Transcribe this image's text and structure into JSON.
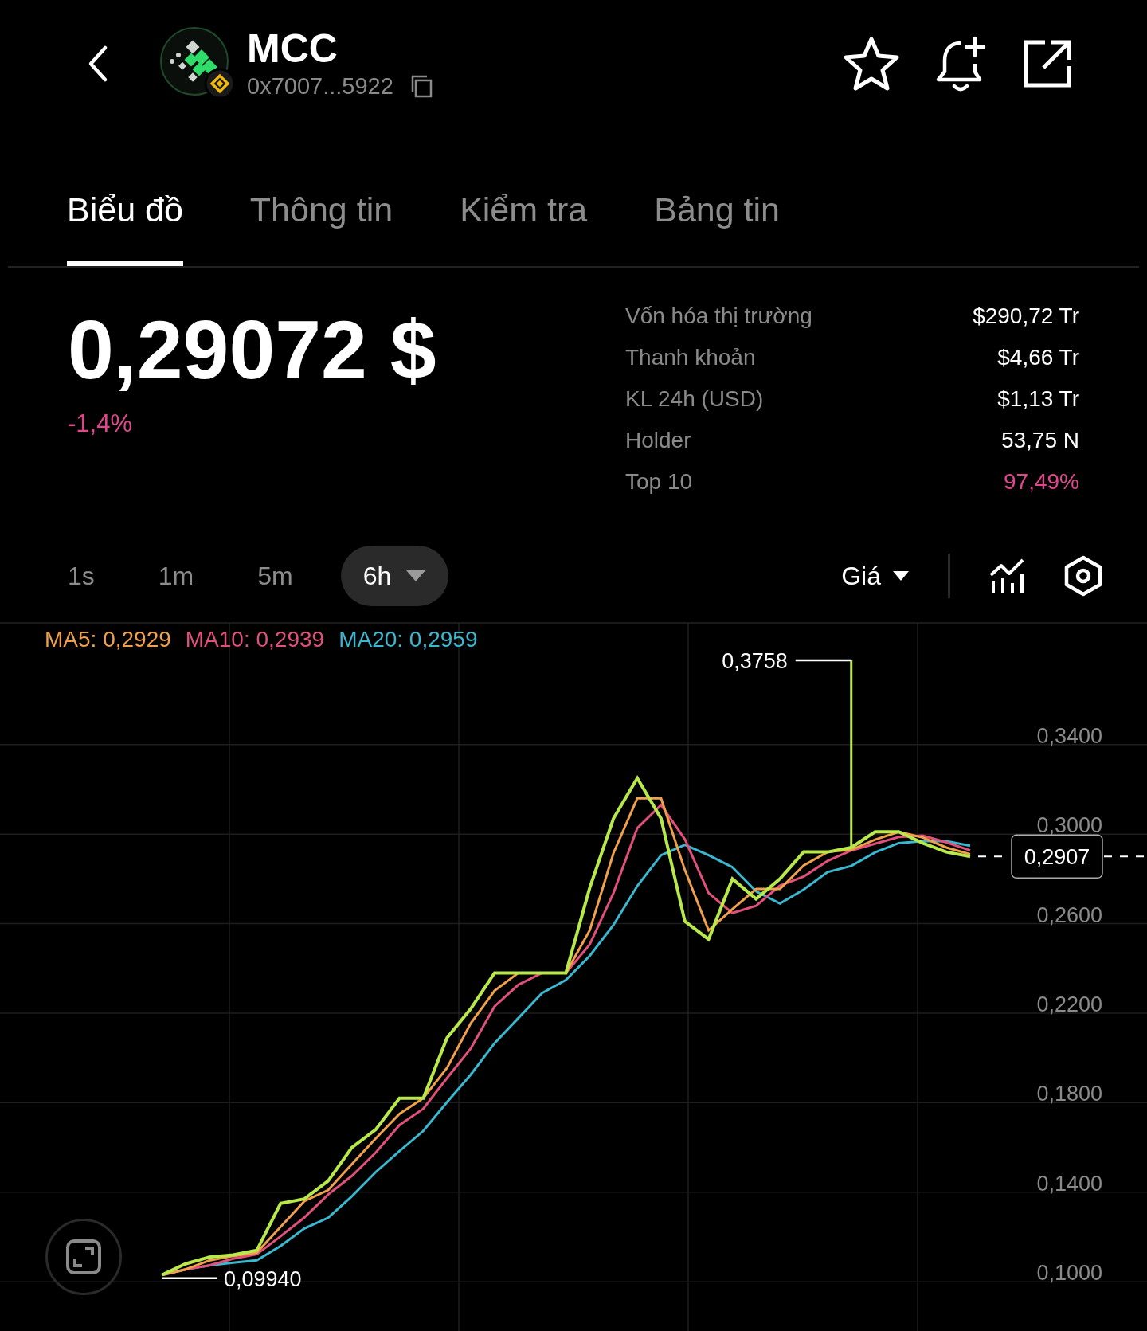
{
  "header": {
    "symbol": "MCC",
    "address": "0x7007...5922"
  },
  "tabs": [
    {
      "label": "Biểu đồ",
      "selected": true
    },
    {
      "label": "Thông tin",
      "selected": false
    },
    {
      "label": "Kiểm tra",
      "selected": false
    },
    {
      "label": "Bảng tin",
      "selected": false
    }
  ],
  "price": {
    "value": "0,29072 $",
    "change": "-1,4%"
  },
  "stats": [
    {
      "label": "Vốn hóa thị trường",
      "value": "$290,72 Tr",
      "highlight": false
    },
    {
      "label": "Thanh khoản",
      "value": "$4,66 Tr",
      "highlight": false
    },
    {
      "label": "KL 24h (USD)",
      "value": "$1,13 Tr",
      "highlight": false
    },
    {
      "label": "Holder",
      "value": "53,75 N",
      "highlight": false
    },
    {
      "label": "Top 10",
      "value": "97,49%",
      "highlight": true
    }
  ],
  "intervals": [
    {
      "label": "1s",
      "selected": false
    },
    {
      "label": "1m",
      "selected": false
    },
    {
      "label": "5m",
      "selected": false
    },
    {
      "label": "6h",
      "selected": true
    }
  ],
  "chart": {
    "last_price": "0,2907",
    "chart_data": {
      "type": "line",
      "grid": true,
      "ylim": [
        0.078,
        0.394
      ],
      "yticks": [
        {
          "value": 0.34,
          "label": "0,3400"
        },
        {
          "value": 0.3,
          "label": "0,3000"
        },
        {
          "value": 0.26,
          "label": "0,2600"
        },
        {
          "value": 0.22,
          "label": "0,2200"
        },
        {
          "value": 0.18,
          "label": "0,1800"
        },
        {
          "value": 0.14,
          "label": "0,1400"
        },
        {
          "value": 0.1,
          "label": "0,1000"
        }
      ],
      "series": [
        {
          "name": "Giá",
          "color": "#b8e84a",
          "values": [
            0.103,
            0.108,
            0.111,
            0.112,
            0.114,
            0.135,
            0.137,
            0.145,
            0.16,
            0.168,
            0.182,
            0.182,
            0.209,
            0.222,
            0.238,
            0.238,
            0.238,
            0.238,
            0.276,
            0.307,
            0.325,
            0.307,
            0.261,
            0.253,
            0.28,
            0.271,
            0.28,
            0.292,
            0.292,
            0.294,
            0.301,
            0.301,
            0.296,
            0.292,
            0.29
          ]
        },
        {
          "name": "MA5: 0,2929",
          "color": "#f0a04a",
          "values": [
            0.103,
            0.1055,
            0.1095,
            0.1115,
            0.113,
            0.1245,
            0.136,
            0.141,
            0.1525,
            0.164,
            0.175,
            0.182,
            0.1955,
            0.2155,
            0.23,
            0.238,
            0.238,
            0.238,
            0.257,
            0.2915,
            0.316,
            0.316,
            0.284,
            0.257,
            0.2665,
            0.2755,
            0.2755,
            0.286,
            0.292,
            0.293,
            0.2975,
            0.301,
            0.2985,
            0.294,
            0.291
          ]
        },
        {
          "name": "MA10: 0,2939",
          "color": "#e0507a",
          "values": [
            0.103,
            0.1055,
            0.1073,
            0.1103,
            0.1123,
            0.1203,
            0.1287,
            0.139,
            0.1473,
            0.1577,
            0.17,
            0.1773,
            0.191,
            0.2043,
            0.223,
            0.2327,
            0.238,
            0.238,
            0.2507,
            0.2737,
            0.3027,
            0.313,
            0.2977,
            0.2737,
            0.2647,
            0.268,
            0.277,
            0.281,
            0.288,
            0.2927,
            0.2957,
            0.2987,
            0.2993,
            0.2963,
            0.2927
          ]
        },
        {
          "name": "MA20: 0,2959",
          "color": "#3ab8d0",
          "values": [
            0.103,
            0.1055,
            0.1073,
            0.1085,
            0.1096,
            0.116,
            0.1238,
            0.1286,
            0.1382,
            0.149,
            0.1584,
            0.1674,
            0.1802,
            0.1926,
            0.2066,
            0.2178,
            0.229,
            0.2348,
            0.2456,
            0.2594,
            0.2768,
            0.2906,
            0.2952,
            0.2906,
            0.2852,
            0.2744,
            0.269,
            0.2752,
            0.283,
            0.2858,
            0.2918,
            0.296,
            0.2968,
            0.2968,
            0.2948
          ]
        }
      ],
      "annotations": [
        {
          "text": "0,3758"
        },
        {
          "text": "0,09940"
        }
      ]
    }
  }
}
